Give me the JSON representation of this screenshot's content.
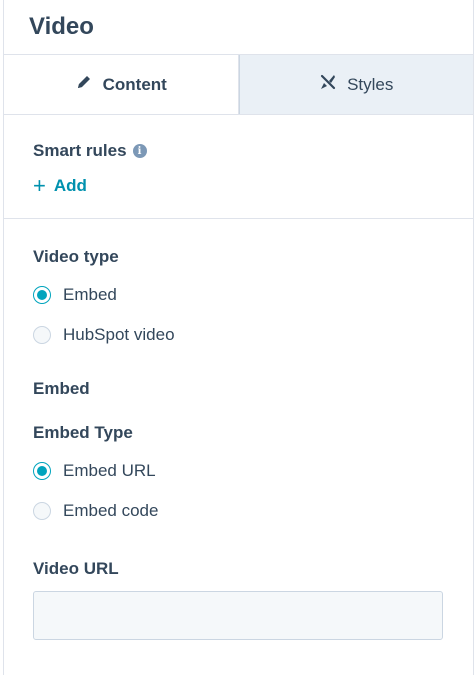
{
  "header": {
    "title": "Video"
  },
  "tabs": [
    {
      "label": "Content",
      "icon": "pencil-icon",
      "active": true
    },
    {
      "label": "Styles",
      "icon": "brush-icon",
      "active": false
    }
  ],
  "smart_rules": {
    "label": "Smart rules",
    "add_label": "Add"
  },
  "video_type": {
    "label": "Video type",
    "options": [
      {
        "label": "Embed",
        "checked": true
      },
      {
        "label": "HubSpot video",
        "checked": false
      }
    ]
  },
  "embed": {
    "section_label": "Embed",
    "type_label": "Embed Type",
    "options": [
      {
        "label": "Embed URL",
        "checked": true
      },
      {
        "label": "Embed code",
        "checked": false
      }
    ]
  },
  "video_url": {
    "label": "Video URL",
    "value": ""
  },
  "colors": {
    "accent": "#00a4bd",
    "link": "#0091ae",
    "text": "#33475b",
    "border": "#dfe3eb"
  }
}
